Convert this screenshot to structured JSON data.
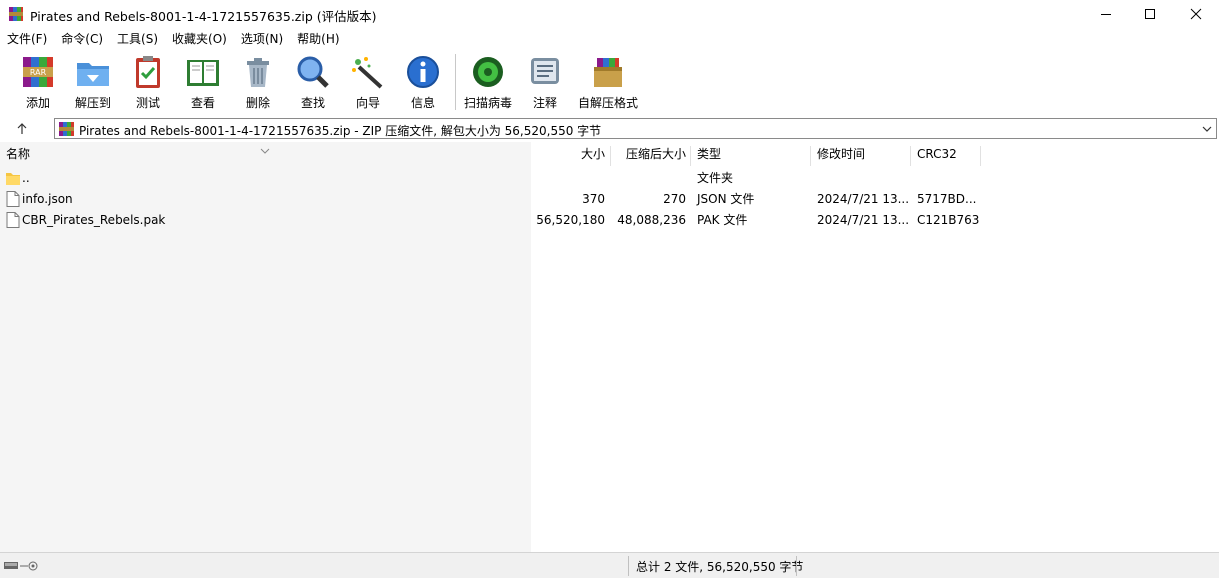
{
  "window": {
    "title": "Pirates and Rebels-8001-1-4-1721557635.zip (评估版本)",
    "controls": [
      "minimize",
      "maximize",
      "close"
    ]
  },
  "menu": [
    "文件(F)",
    "命令(C)",
    "工具(S)",
    "收藏夹(O)",
    "选项(N)",
    "帮助(H)"
  ],
  "toolbar": {
    "buttons": [
      {
        "label": "添加",
        "icon": "add-archive-icon"
      },
      {
        "label": "解压到",
        "icon": "extract-folder-icon"
      },
      {
        "label": "测试",
        "icon": "test-clipboard-icon"
      },
      {
        "label": "查看",
        "icon": "view-book-icon"
      },
      {
        "label": "删除",
        "icon": "trash-icon"
      },
      {
        "label": "查找",
        "icon": "find-magnifier-icon"
      },
      {
        "label": "向导",
        "icon": "wizard-wand-icon"
      },
      {
        "label": "信息",
        "icon": "info-icon"
      },
      {
        "label": "扫描病毒",
        "icon": "virus-scan-icon"
      },
      {
        "label": "注释",
        "icon": "comment-icon"
      },
      {
        "label": "自解压格式",
        "icon": "sfx-box-icon"
      }
    ]
  },
  "address": {
    "text": "Pirates and Rebels-8001-1-4-1721557635.zip - ZIP 压缩文件, 解包大小为 56,520,550 字节"
  },
  "columns": {
    "name": "名称",
    "size": "大小",
    "packed": "压缩后大小",
    "type": "类型",
    "modified": "修改时间",
    "crc": "CRC32"
  },
  "files": [
    {
      "name": "..",
      "size": "",
      "packed": "",
      "type": "文件夹",
      "modified": "",
      "crc": "",
      "icon": "folder-icon"
    },
    {
      "name": "info.json",
      "size": "370",
      "packed": "270",
      "type": "JSON 文件",
      "modified": "2024/7/21 13...",
      "crc": "5717BD...",
      "icon": "file-icon"
    },
    {
      "name": "CBR_Pirates_Rebels.pak",
      "size": "56,520,180",
      "packed": "48,088,236",
      "type": "PAK 文件",
      "modified": "2024/7/21 13...",
      "crc": "C121B763",
      "icon": "file-icon"
    }
  ],
  "status": {
    "text": "总计 2 文件, 56,520,550 字节"
  }
}
